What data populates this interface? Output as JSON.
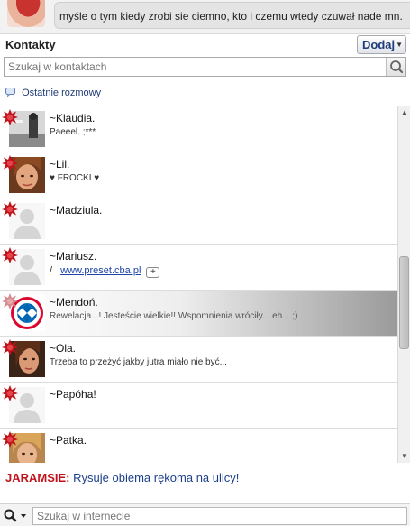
{
  "status": {
    "text": "myśle o tym kiedy zrobi sie ciemno,  kto i czemu wtedy czuwał nade mn."
  },
  "header": {
    "title": "Kontakty",
    "add_label": "Dodaj"
  },
  "contact_search": {
    "placeholder": "Szukaj w kontaktach"
  },
  "recent": {
    "label": "Ostatnie rozmowy"
  },
  "contacts": [
    {
      "name": "~Klaudia.",
      "status": "Paeeel. ;***",
      "avatar": "bw-photo",
      "selected": false
    },
    {
      "name": "~Lil.",
      "status": "♥ FROCKI ♥",
      "avatar": "girl-photo",
      "selected": false
    },
    {
      "name": "~Madziula.",
      "status": "",
      "avatar": "default",
      "selected": false
    },
    {
      "name": "~Mariusz.",
      "status": "/",
      "link": "www.preset.cba.pl",
      "badge": "+",
      "avatar": "default",
      "selected": false
    },
    {
      "name": "~Mendoń.",
      "status": "Rewelacja...! Jesteście wielkie!! Wspomnienia wróciły... eh... ;)",
      "avatar": "bayern-logo",
      "selected": true
    },
    {
      "name": "~Ola.",
      "status": "Trzeba to przeżyć jakby jutra miało nie być...",
      "avatar": "girl-photo-2",
      "selected": false
    },
    {
      "name": "~Papóha!",
      "status": "",
      "avatar": "default",
      "selected": false
    },
    {
      "name": "~Patka.",
      "status": "",
      "avatar": "blonde-photo",
      "selected": false
    }
  ],
  "ticker": {
    "author": "JARAMSIE:",
    "text": "Rysuje obiema rękoma na ulicy!"
  },
  "web_search": {
    "placeholder": "Szukaj w internecie"
  },
  "colors": {
    "status_away": "#c0121b",
    "link": "#1c43a5",
    "ticker_author": "#c1121b",
    "ticker_text": "#1c3f8a"
  }
}
